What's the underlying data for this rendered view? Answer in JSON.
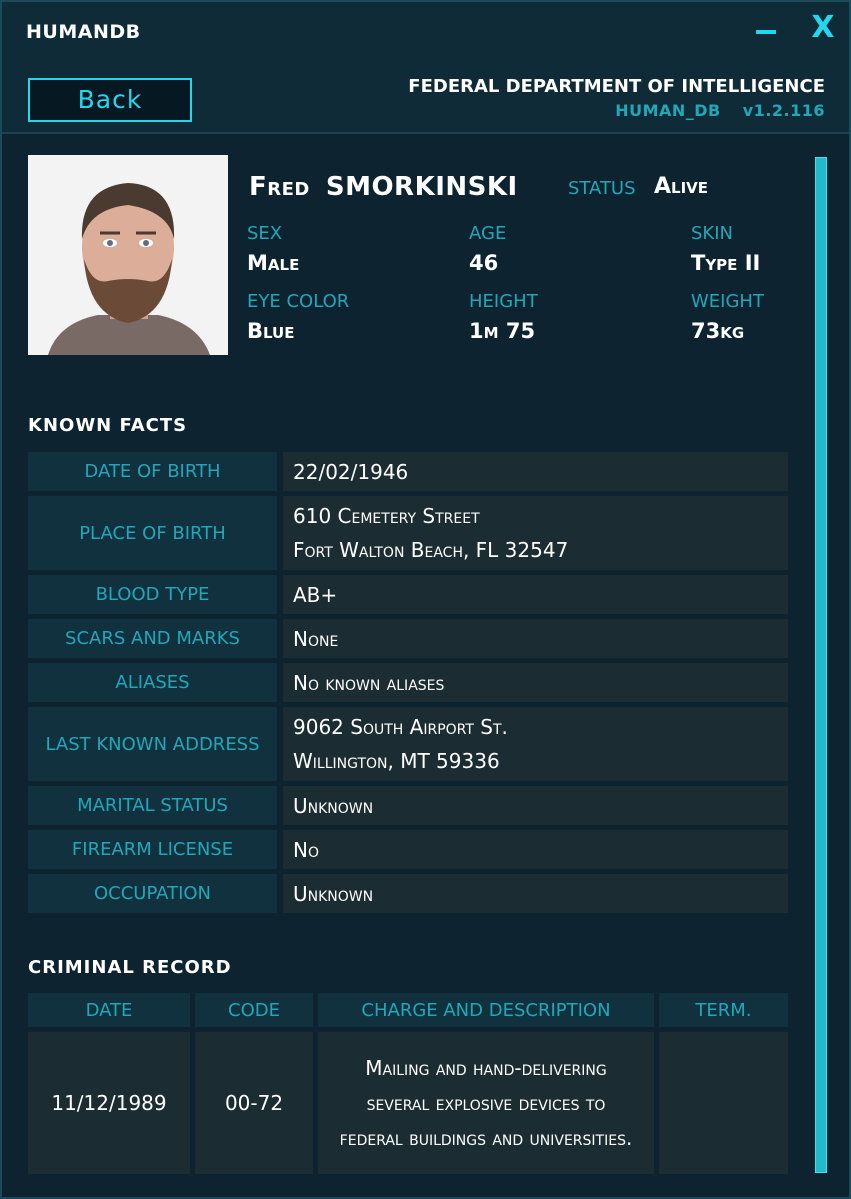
{
  "app": {
    "title": "HUMANDB",
    "minimize_glyph": "–",
    "close_glyph": "X"
  },
  "header": {
    "back_label": "Back",
    "agency": "FEDERAL DEPARTMENT OF INTELLIGENCE",
    "db_name": "HUMAN_DB",
    "version": "v1.2.116"
  },
  "profile": {
    "first_name": "Fred",
    "last_name": "SMORKINSKI",
    "status_label": "STATUS",
    "status_value": "Alive",
    "stats": [
      {
        "label": "SEX",
        "value": "Male"
      },
      {
        "label": "AGE",
        "value": "46"
      },
      {
        "label": "SKIN",
        "value": "Type II"
      },
      {
        "label": "EYE COLOR",
        "value": "Blue"
      },
      {
        "label": "HEIGHT",
        "value": "1m 75"
      },
      {
        "label": "WEIGHT",
        "value": "73kg"
      }
    ]
  },
  "known_facts": {
    "title": "KNOWN  FACTS",
    "rows": [
      {
        "label": "DATE OF BIRTH",
        "lines": [
          "22/02/1946"
        ]
      },
      {
        "label": "PLACE OF BIRTH",
        "lines": [
          "610 Cemetery Street",
          "Fort Walton Beach, FL 32547"
        ]
      },
      {
        "label": "BLOOD TYPE",
        "lines": [
          "AB+"
        ]
      },
      {
        "label": "SCARS AND MARKS",
        "lines": [
          "None"
        ]
      },
      {
        "label": "ALIASES",
        "lines": [
          "No known aliases"
        ]
      },
      {
        "label": "LAST KNOWN ADDRESS",
        "lines": [
          "9062 South Airport St.",
          "Willington, MT 59336"
        ]
      },
      {
        "label": "MARITAL STATUS",
        "lines": [
          "Unknown"
        ]
      },
      {
        "label": "FIREARM LICENSE",
        "lines": [
          "No"
        ]
      },
      {
        "label": "OCCUPATION",
        "lines": [
          "Unknown"
        ]
      }
    ]
  },
  "criminal_record": {
    "title": "CRIMINAL  RECORD",
    "headers": [
      "DATE",
      "CODE",
      "CHARGE AND DESCRIPTION",
      "TERM."
    ],
    "rows": [
      {
        "date": "11/12/1989",
        "code": "00-72",
        "description": "Mailing and hand-delivering several explosive devices to federal buildings and universities.",
        "term": ""
      }
    ]
  },
  "colors": {
    "accent": "#22d8ef",
    "label": "#22a7b8",
    "bg": "#0d2330"
  }
}
